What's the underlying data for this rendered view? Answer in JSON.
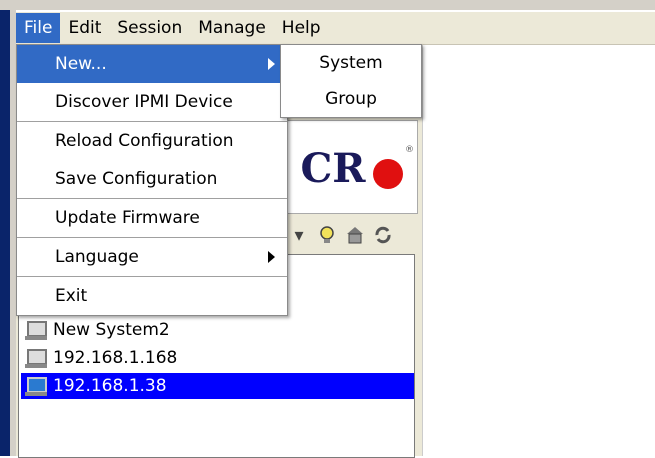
{
  "menubar": {
    "items": [
      "File",
      "Edit",
      "Session",
      "Manage",
      "Help"
    ]
  },
  "file_menu": {
    "items": [
      {
        "label": "New...",
        "has_submenu": true,
        "highlighted": true
      },
      {
        "label": "Discover IPMI Device"
      },
      {
        "label": "Reload Configuration"
      },
      {
        "label": "Save Configuration"
      },
      {
        "label": "Update Firmware"
      },
      {
        "label": "Language",
        "has_submenu": true
      },
      {
        "label": "Exit"
      }
    ]
  },
  "new_submenu": {
    "items": [
      "System",
      "Group"
    ]
  },
  "logo": {
    "text": "CR",
    "registered": "®"
  },
  "toolbar": {
    "icons": [
      "dropdown-arrow-icon",
      "lightbulb-icon",
      "home-icon",
      "refresh-icon"
    ]
  },
  "tree": {
    "items": [
      {
        "label": "New System2",
        "selected": false
      },
      {
        "label": "192.168.1.168",
        "selected": false
      },
      {
        "label": "192.168.1.38",
        "selected": true
      }
    ]
  },
  "colors": {
    "highlight": "#316ac5",
    "selection": "#0000ff",
    "menubar_bg": "#ece9d8"
  }
}
